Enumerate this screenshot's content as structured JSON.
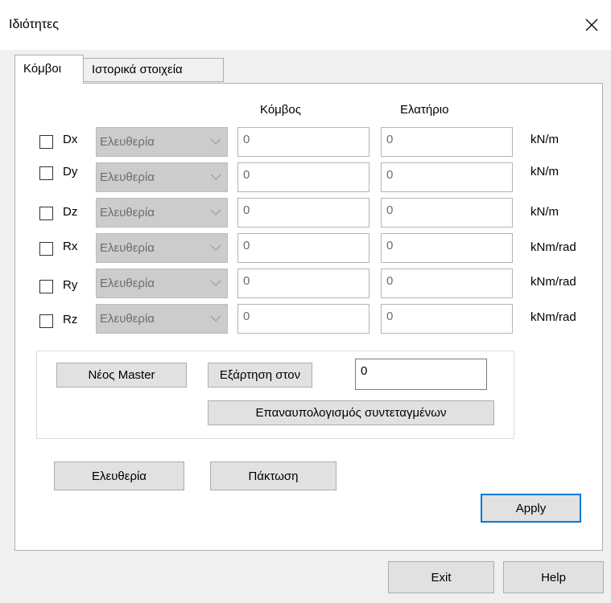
{
  "window": {
    "title": "Ιδιότητες"
  },
  "tabs": [
    {
      "label": "Κόμβοι",
      "active": true
    },
    {
      "label": "Ιστορικά στοιχεία",
      "active": false
    }
  ],
  "columns": {
    "node": "Κόμβος",
    "spring": "Ελατήριο"
  },
  "rows": [
    {
      "dof": "Dx",
      "checked": false,
      "mode": "Ελευθερία",
      "node_value": "0",
      "spring_value": "0",
      "unit": "kN/m"
    },
    {
      "dof": "Dy",
      "checked": false,
      "mode": "Ελευθερία",
      "node_value": "0",
      "spring_value": "0",
      "unit": "kN/m"
    },
    {
      "dof": "Dz",
      "checked": false,
      "mode": "Ελευθερία",
      "node_value": "0",
      "spring_value": "0",
      "unit": "kN/m"
    },
    {
      "dof": "Rx",
      "checked": false,
      "mode": "Ελευθερία",
      "node_value": "0",
      "spring_value": "0",
      "unit": "kNm/rad"
    },
    {
      "dof": "Ry",
      "checked": false,
      "mode": "Ελευθερία",
      "node_value": "0",
      "spring_value": "0",
      "unit": "kNm/rad"
    },
    {
      "dof": "Rz",
      "checked": false,
      "mode": "Ελευθερία",
      "node_value": "0",
      "spring_value": "0",
      "unit": "kNm/rad"
    }
  ],
  "master": {
    "new_master_label": "Νέος Master",
    "dependency_label": "Εξάρτηση στον",
    "dependency_value": "0",
    "recalc_label": "Επαναυπολογισμός συντεταγμένων"
  },
  "actions": {
    "free_label": "Ελευθερία",
    "fixed_label": "Πάκτωση",
    "apply_label": "Apply",
    "exit_label": "Exit",
    "help_label": "Help"
  },
  "colors": {
    "accent": "#0078d7",
    "disabled_combo": "#cccccc",
    "button": "#e1e1e1"
  }
}
